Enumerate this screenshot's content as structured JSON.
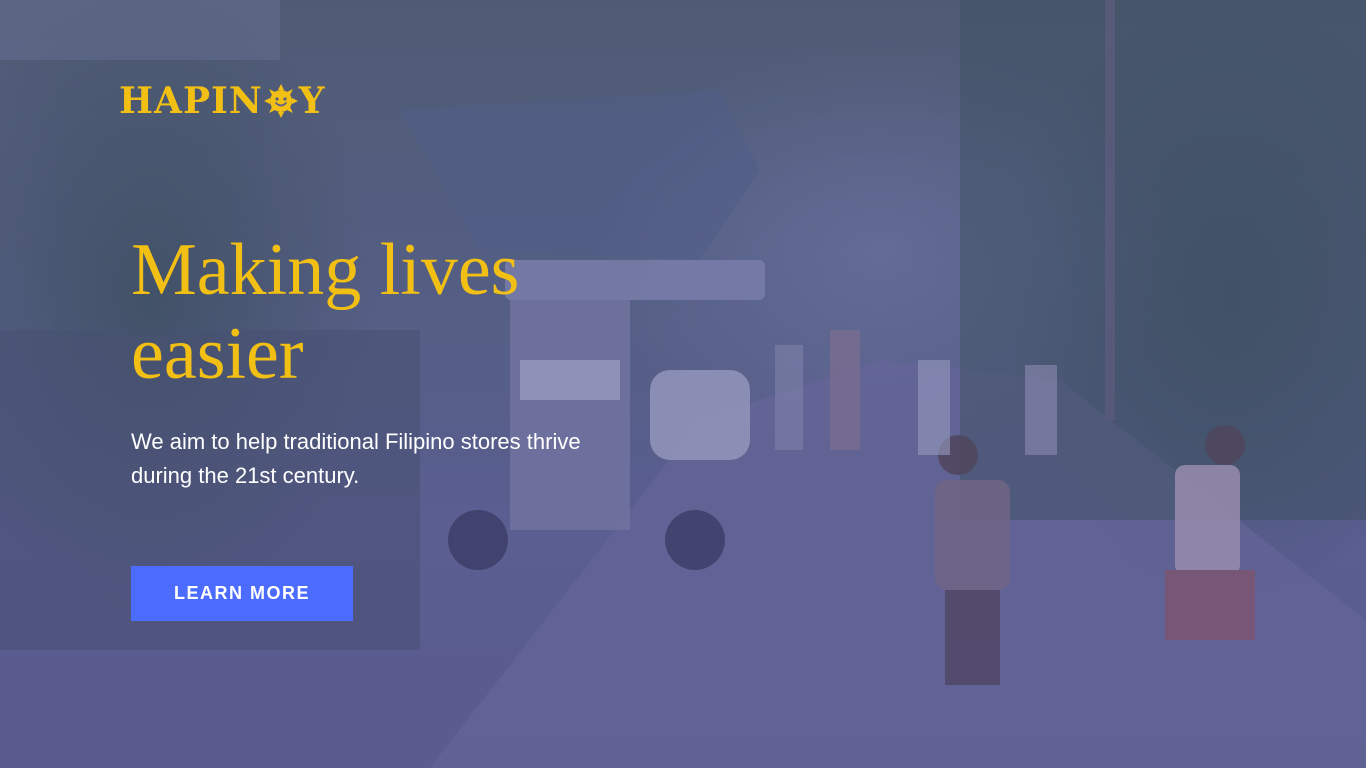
{
  "brand": {
    "logo_prefix": "HAPIN",
    "logo_suffix": "Y",
    "logo_color": "#f2bf14",
    "logo_icon": "smiling-sun-icon"
  },
  "hero": {
    "headline": "Making lives easier",
    "subtext": "We aim to help traditional Filipino stores thrive during the 21st century.",
    "headline_color": "#f2bf14",
    "background": "photo of a village street with children and a tricycle"
  },
  "cta": {
    "label": "LEARN MORE",
    "color": "#4c6cff"
  }
}
